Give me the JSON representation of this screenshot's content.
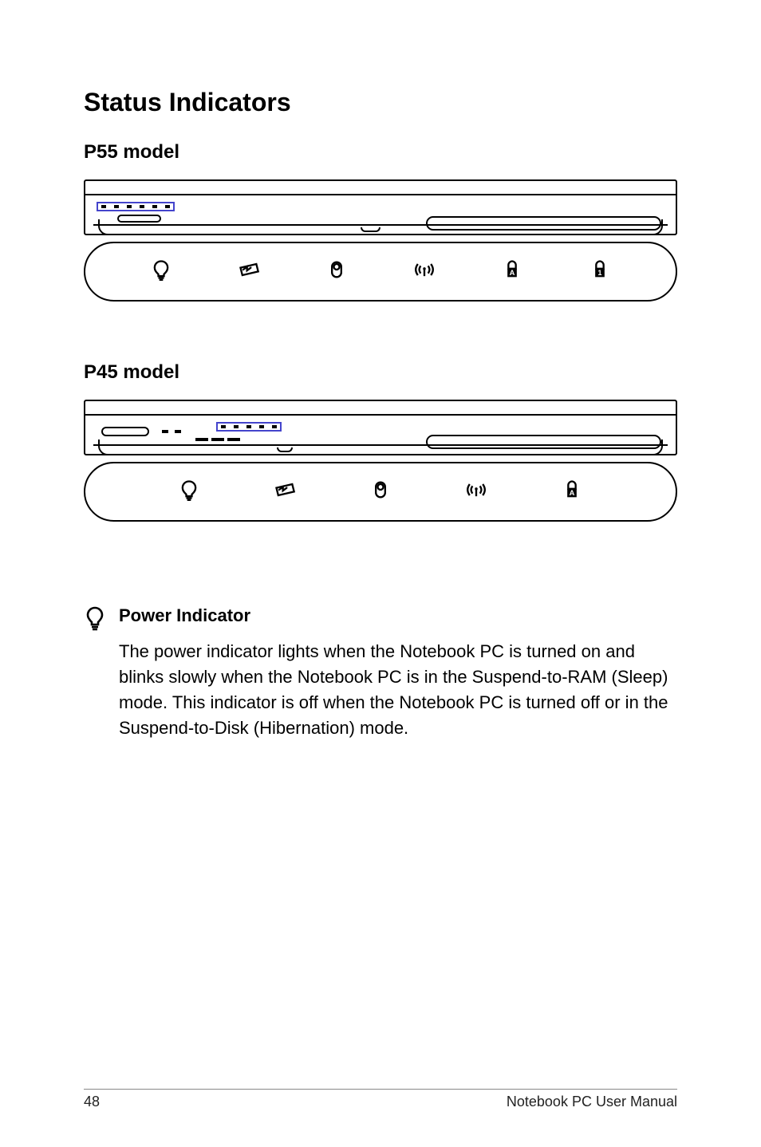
{
  "title": "Status Indicators",
  "sections": {
    "p55": {
      "heading": "P55 model",
      "icons": [
        "power",
        "battery",
        "drive",
        "wireless",
        "caps-lock",
        "num-lock"
      ]
    },
    "p45": {
      "heading": "P45 model",
      "icons": [
        "power",
        "battery",
        "drive",
        "wireless",
        "caps-lock"
      ]
    }
  },
  "indicator": {
    "icon": "power",
    "heading": "Power Indicator",
    "body": "The power indicator lights when the Notebook PC is turned on and blinks slowly when the Notebook PC is in the Suspend-to-RAM (Sleep) mode. This indicator is off when the Notebook PC is turned off or in the Suspend-to-Disk (Hibernation) mode."
  },
  "footer": {
    "page": "48",
    "manual": "Notebook PC User Manual"
  }
}
